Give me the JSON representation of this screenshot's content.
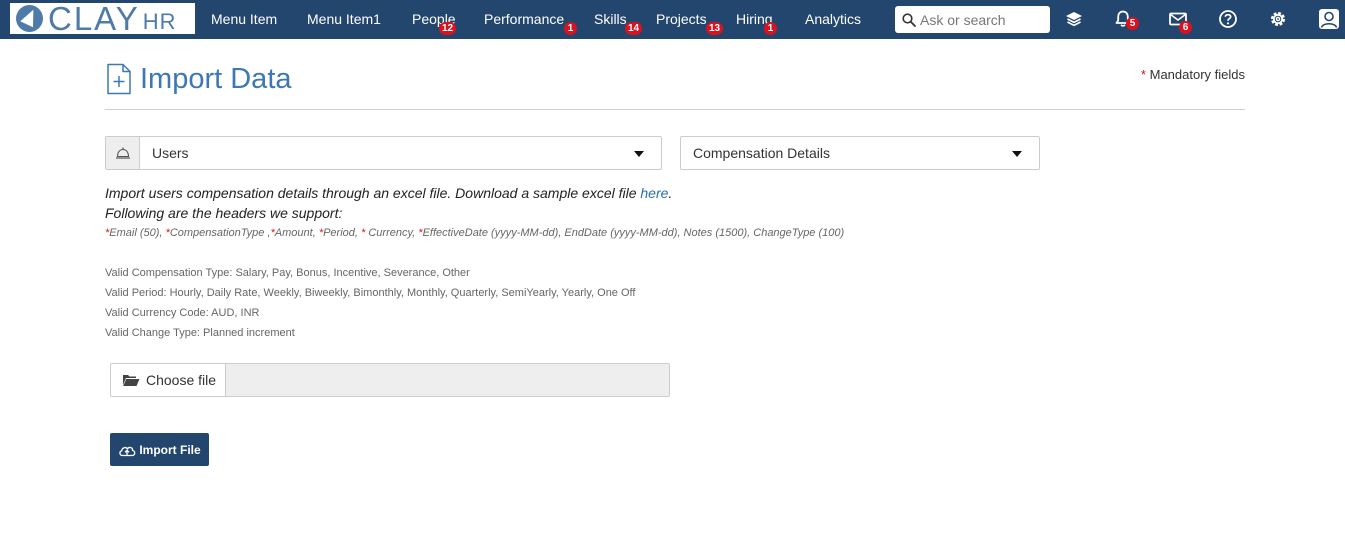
{
  "brand": {
    "logo_text": "CLAY",
    "logo_suffix": "HR"
  },
  "nav": {
    "items": [
      {
        "label": "Menu Item",
        "badge": ""
      },
      {
        "label": "Menu Item1",
        "badge": ""
      },
      {
        "label": "People",
        "badge": "12"
      },
      {
        "label": "Performance",
        "badge": "1"
      },
      {
        "label": "Skills",
        "badge": "14"
      },
      {
        "label": "Projects",
        "badge": "13"
      },
      {
        "label": "Hiring",
        "badge": "1"
      },
      {
        "label": "Analytics",
        "badge": ""
      }
    ],
    "search_placeholder": "Ask or search",
    "icons": {
      "layers": "layers-icon",
      "notifications": {
        "icon": "bell-icon",
        "badge": "5"
      },
      "messages": {
        "icon": "envelope-icon",
        "badge": "6"
      },
      "help": "help-icon",
      "settings": "gear-icon",
      "profile": "user-avatar-icon"
    }
  },
  "page": {
    "title": "Import Data",
    "mandatory_star": "*",
    "mandatory_label": "Mandatory fields"
  },
  "form": {
    "entity_select": {
      "value": "Users"
    },
    "type_select": {
      "value": "Compensation Details"
    },
    "instructions_prefix": "Import users compensation details through an excel file. Download a sample excel file ",
    "instructions_link": "here",
    "instructions_suffix": ".",
    "headers_intro": "Following are the headers we support:",
    "headers": [
      {
        "star": true,
        "text": "Email (50), "
      },
      {
        "star": true,
        "text": "CompensationType ,"
      },
      {
        "star": true,
        "text": "Amount, "
      },
      {
        "star": true,
        "text": "Period, "
      },
      {
        "star": true,
        "text": " Currency, "
      },
      {
        "star": true,
        "text": "EffectiveDate (yyyy-MM-dd), EndDate (yyyy-MM-dd), Notes (1500), ChangeType (100)"
      }
    ],
    "valid_lines": [
      "Valid Compensation Type: Salary, Pay, Bonus, Incentive, Severance, Other",
      "Valid Period: Hourly, Daily Rate, Weekly, Biweekly, Bimonthly, Monthly, Quarterly, SemiYearly, Yearly, One Off",
      "Valid Currency Code: AUD, INR",
      "Valid Change Type: Planned increment"
    ],
    "choose_file_label": "Choose file",
    "import_button_label": "Import File"
  },
  "colors": {
    "navbar": "#23466e",
    "accent": "#3d78b4",
    "badge": "#d9121f"
  }
}
